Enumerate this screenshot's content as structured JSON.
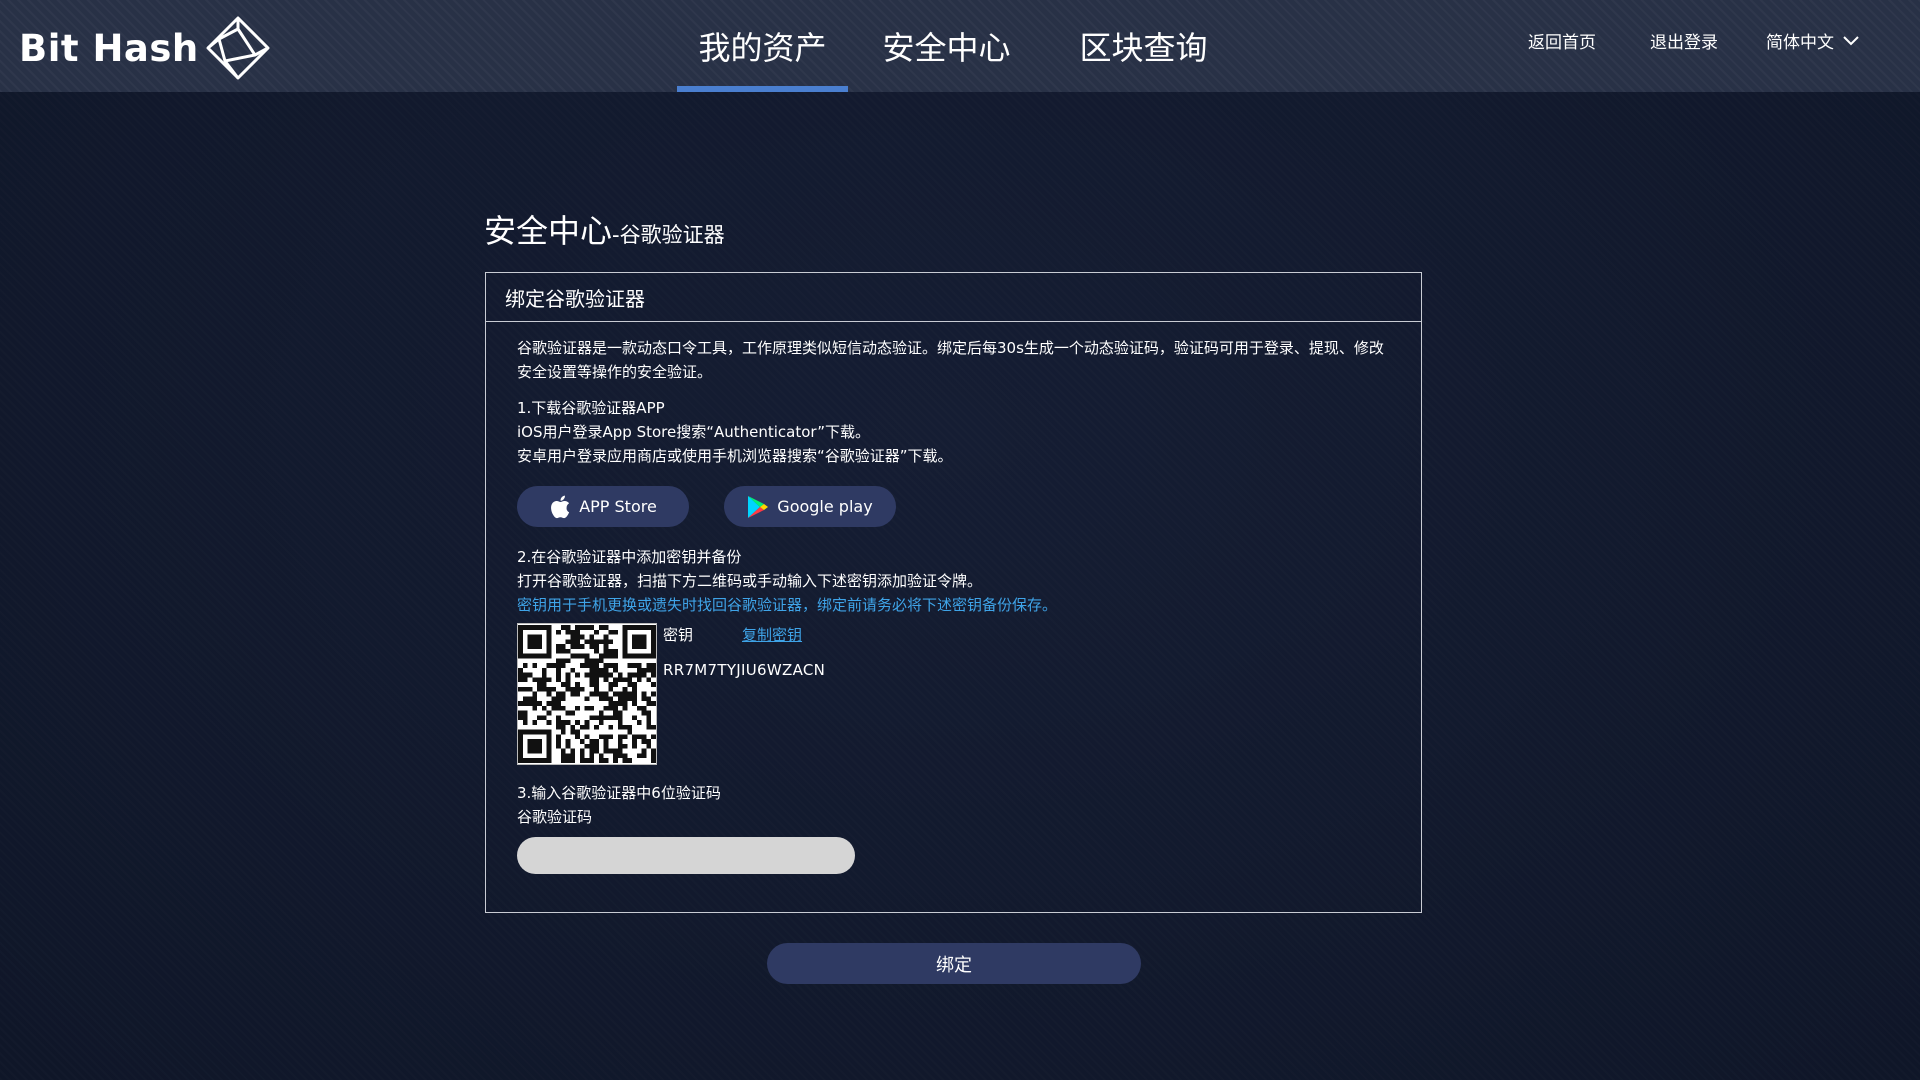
{
  "header": {
    "logo_text": "Bit Hash",
    "nav": [
      {
        "label": "我的资产",
        "active": true
      },
      {
        "label": "安全中心",
        "active": false
      },
      {
        "label": "区块查询",
        "active": false
      }
    ],
    "home_link": "返回首页",
    "logout_link": "退出登录",
    "language": "简体中文",
    "accent_color": "#4a7fd0"
  },
  "page": {
    "title_main": "安全中心",
    "title_sub": "-谷歌验证器"
  },
  "panel": {
    "heading": "绑定谷歌验证器",
    "intro": "谷歌验证器是一款动态口令工具，工作原理类似短信动态验证。绑定后每30s生成一个动态验证码，验证码可用于登录、提现、修改安全设置等操作的安全验证。",
    "step1_title": "1.下载谷歌验证器APP",
    "step1_ios": "iOS用户登录App Store搜索“Authenticator”下载。",
    "step1_android": "安卓用户登录应用商店或使用手机浏览器搜索“谷歌验证器”下载。",
    "appstore_label": "APP Store",
    "googleplay_label": "Google play",
    "step2_title": "2.在谷歌验证器中添加密钥并备份",
    "step2_desc": "打开谷歌验证器，扫描下方二维码或手动输入下述密钥添加验证令牌。",
    "step2_warning": "密钥用于手机更换或遗失时找回谷歌验证器，绑定前请务必将下述密钥备份保存。",
    "key_label": "密钥",
    "copy_key": "复制密钥",
    "key_value": "RR7M7TYJIU6WZACN",
    "step3_title": "3.输入谷歌验证器中6位验证码",
    "code_label": "谷歌验证码",
    "code_value": "",
    "highlight_color": "#3fa4e8"
  },
  "bind_button": "绑定"
}
